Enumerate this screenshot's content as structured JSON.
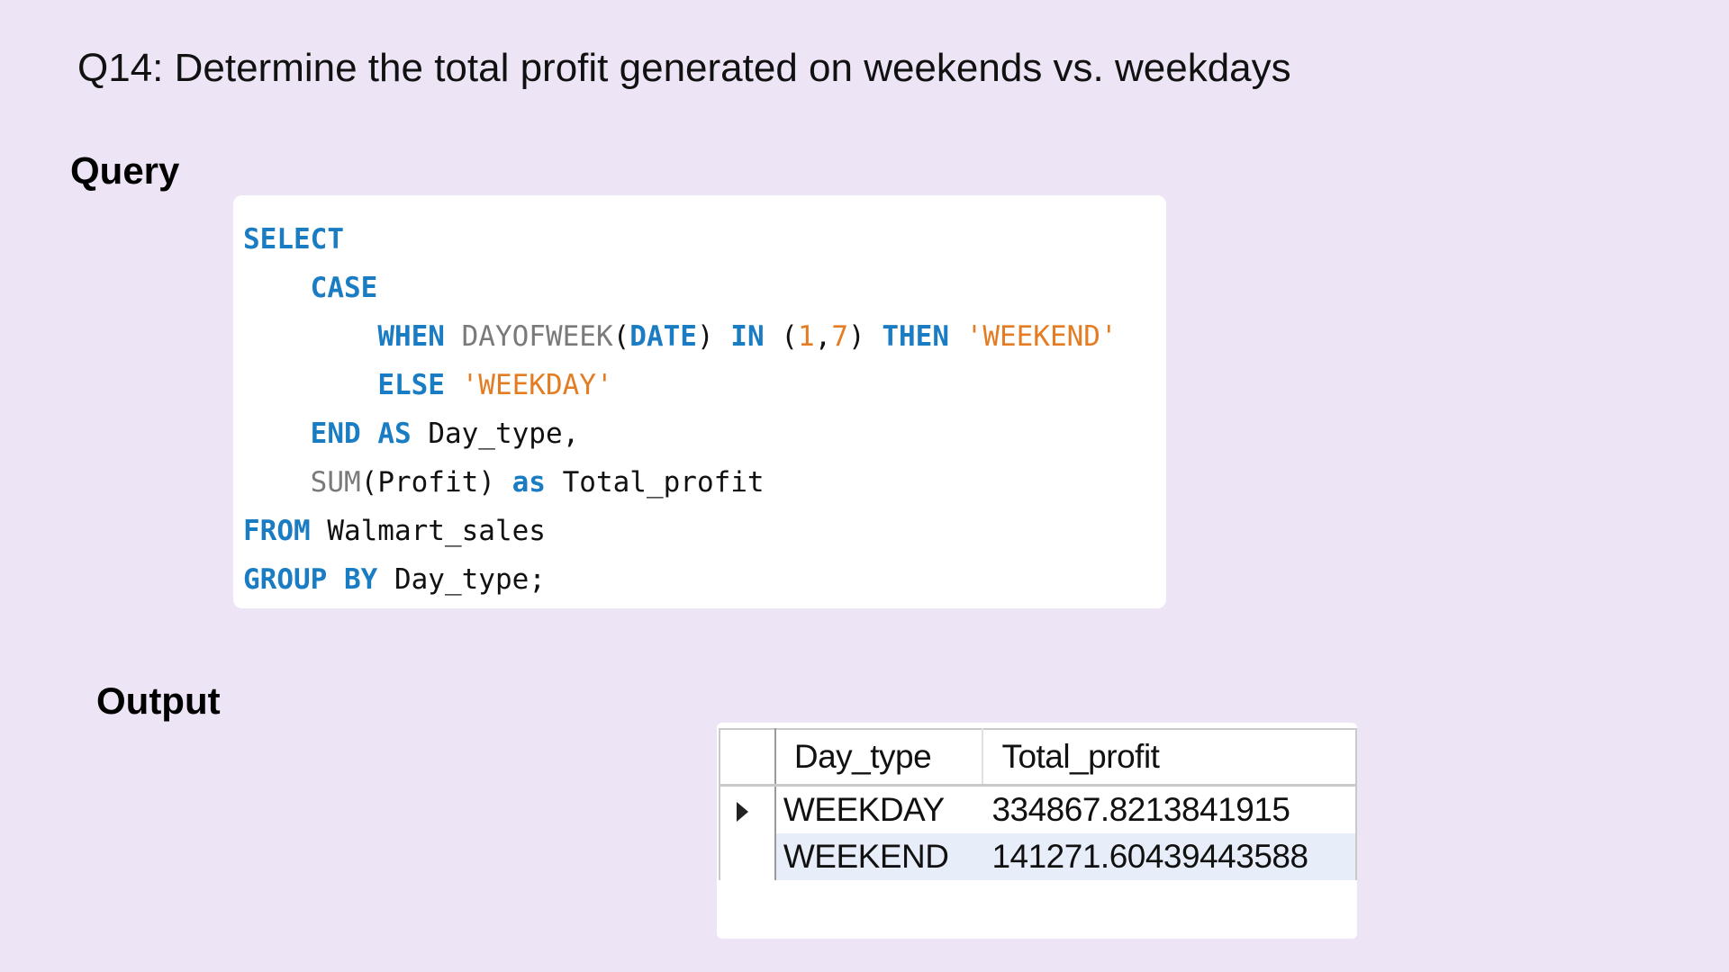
{
  "title": "Q14: Determine the total profit generated on weekends vs. weekdays",
  "sections": {
    "query_label": "Query",
    "output_label": "Output"
  },
  "code": {
    "lines": [
      [
        {
          "t": "SELECT",
          "c": "kw"
        }
      ],
      [
        {
          "t": "    "
        },
        {
          "t": "CASE",
          "c": "kw"
        }
      ],
      [
        {
          "t": "        "
        },
        {
          "t": "WHEN",
          "c": "kw"
        },
        {
          "t": " "
        },
        {
          "t": "DAYOFWEEK",
          "c": "fn"
        },
        {
          "t": "(",
          "c": "pun"
        },
        {
          "t": "DATE",
          "c": "kw"
        },
        {
          "t": ")",
          "c": "pun"
        },
        {
          "t": " "
        },
        {
          "t": "IN",
          "c": "kw"
        },
        {
          "t": " "
        },
        {
          "t": "(",
          "c": "pun"
        },
        {
          "t": "1",
          "c": "num"
        },
        {
          "t": ",",
          "c": "pun"
        },
        {
          "t": "7",
          "c": "num"
        },
        {
          "t": ")",
          "c": "pun"
        },
        {
          "t": " "
        },
        {
          "t": "THEN",
          "c": "kw"
        },
        {
          "t": " "
        },
        {
          "t": "'WEEKEND'",
          "c": "str"
        }
      ],
      [
        {
          "t": "        "
        },
        {
          "t": "ELSE",
          "c": "kw"
        },
        {
          "t": " "
        },
        {
          "t": "'WEEKDAY'",
          "c": "str"
        }
      ],
      [
        {
          "t": "    "
        },
        {
          "t": "END",
          "c": "kw"
        },
        {
          "t": " "
        },
        {
          "t": "AS",
          "c": "kw"
        },
        {
          "t": " Day_type,"
        }
      ],
      [
        {
          "t": "    "
        },
        {
          "t": "SUM",
          "c": "fn"
        },
        {
          "t": "(Profit)"
        },
        {
          "t": " "
        },
        {
          "t": "as",
          "c": "kw"
        },
        {
          "t": " Total_profit"
        }
      ],
      [
        {
          "t": "FROM",
          "c": "kw"
        },
        {
          "t": " Walmart_sales"
        }
      ],
      [
        {
          "t": "GROUP BY",
          "c": "kw"
        },
        {
          "t": " Day_type;"
        }
      ]
    ]
  },
  "result": {
    "headers": [
      "Day_type",
      "Total_profit"
    ],
    "rows": [
      {
        "day_type": "WEEKDAY",
        "total_profit": "334867.8213841915",
        "current": true
      },
      {
        "day_type": "WEEKEND",
        "total_profit": "141271.60439443588",
        "current": false
      }
    ],
    "selected_row": 1
  }
}
